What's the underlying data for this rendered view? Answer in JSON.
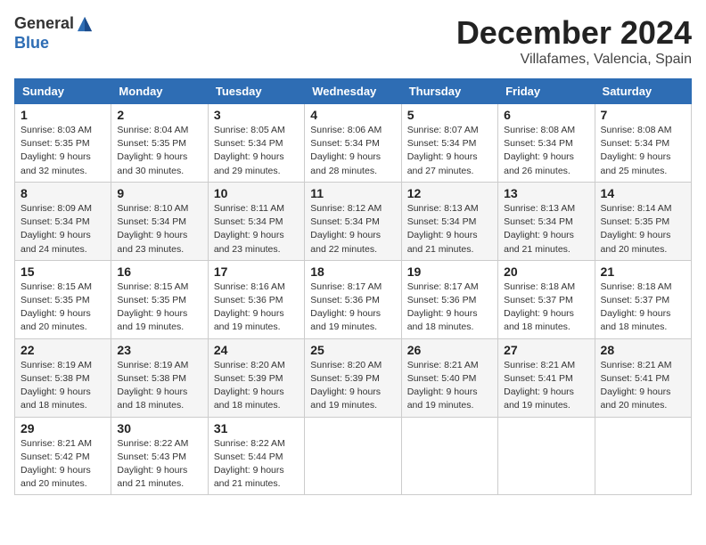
{
  "header": {
    "logo_general": "General",
    "logo_blue": "Blue",
    "month_title": "December 2024",
    "location": "Villafames, Valencia, Spain"
  },
  "weekdays": [
    "Sunday",
    "Monday",
    "Tuesday",
    "Wednesday",
    "Thursday",
    "Friday",
    "Saturday"
  ],
  "weeks": [
    [
      {
        "day": "1",
        "sunrise": "Sunrise: 8:03 AM",
        "sunset": "Sunset: 5:35 PM",
        "daylight": "Daylight: 9 hours and 32 minutes."
      },
      {
        "day": "2",
        "sunrise": "Sunrise: 8:04 AM",
        "sunset": "Sunset: 5:35 PM",
        "daylight": "Daylight: 9 hours and 30 minutes."
      },
      {
        "day": "3",
        "sunrise": "Sunrise: 8:05 AM",
        "sunset": "Sunset: 5:34 PM",
        "daylight": "Daylight: 9 hours and 29 minutes."
      },
      {
        "day": "4",
        "sunrise": "Sunrise: 8:06 AM",
        "sunset": "Sunset: 5:34 PM",
        "daylight": "Daylight: 9 hours and 28 minutes."
      },
      {
        "day": "5",
        "sunrise": "Sunrise: 8:07 AM",
        "sunset": "Sunset: 5:34 PM",
        "daylight": "Daylight: 9 hours and 27 minutes."
      },
      {
        "day": "6",
        "sunrise": "Sunrise: 8:08 AM",
        "sunset": "Sunset: 5:34 PM",
        "daylight": "Daylight: 9 hours and 26 minutes."
      },
      {
        "day": "7",
        "sunrise": "Sunrise: 8:08 AM",
        "sunset": "Sunset: 5:34 PM",
        "daylight": "Daylight: 9 hours and 25 minutes."
      }
    ],
    [
      {
        "day": "8",
        "sunrise": "Sunrise: 8:09 AM",
        "sunset": "Sunset: 5:34 PM",
        "daylight": "Daylight: 9 hours and 24 minutes."
      },
      {
        "day": "9",
        "sunrise": "Sunrise: 8:10 AM",
        "sunset": "Sunset: 5:34 PM",
        "daylight": "Daylight: 9 hours and 23 minutes."
      },
      {
        "day": "10",
        "sunrise": "Sunrise: 8:11 AM",
        "sunset": "Sunset: 5:34 PM",
        "daylight": "Daylight: 9 hours and 23 minutes."
      },
      {
        "day": "11",
        "sunrise": "Sunrise: 8:12 AM",
        "sunset": "Sunset: 5:34 PM",
        "daylight": "Daylight: 9 hours and 22 minutes."
      },
      {
        "day": "12",
        "sunrise": "Sunrise: 8:13 AM",
        "sunset": "Sunset: 5:34 PM",
        "daylight": "Daylight: 9 hours and 21 minutes."
      },
      {
        "day": "13",
        "sunrise": "Sunrise: 8:13 AM",
        "sunset": "Sunset: 5:34 PM",
        "daylight": "Daylight: 9 hours and 21 minutes."
      },
      {
        "day": "14",
        "sunrise": "Sunrise: 8:14 AM",
        "sunset": "Sunset: 5:35 PM",
        "daylight": "Daylight: 9 hours and 20 minutes."
      }
    ],
    [
      {
        "day": "15",
        "sunrise": "Sunrise: 8:15 AM",
        "sunset": "Sunset: 5:35 PM",
        "daylight": "Daylight: 9 hours and 20 minutes."
      },
      {
        "day": "16",
        "sunrise": "Sunrise: 8:15 AM",
        "sunset": "Sunset: 5:35 PM",
        "daylight": "Daylight: 9 hours and 19 minutes."
      },
      {
        "day": "17",
        "sunrise": "Sunrise: 8:16 AM",
        "sunset": "Sunset: 5:36 PM",
        "daylight": "Daylight: 9 hours and 19 minutes."
      },
      {
        "day": "18",
        "sunrise": "Sunrise: 8:17 AM",
        "sunset": "Sunset: 5:36 PM",
        "daylight": "Daylight: 9 hours and 19 minutes."
      },
      {
        "day": "19",
        "sunrise": "Sunrise: 8:17 AM",
        "sunset": "Sunset: 5:36 PM",
        "daylight": "Daylight: 9 hours and 18 minutes."
      },
      {
        "day": "20",
        "sunrise": "Sunrise: 8:18 AM",
        "sunset": "Sunset: 5:37 PM",
        "daylight": "Daylight: 9 hours and 18 minutes."
      },
      {
        "day": "21",
        "sunrise": "Sunrise: 8:18 AM",
        "sunset": "Sunset: 5:37 PM",
        "daylight": "Daylight: 9 hours and 18 minutes."
      }
    ],
    [
      {
        "day": "22",
        "sunrise": "Sunrise: 8:19 AM",
        "sunset": "Sunset: 5:38 PM",
        "daylight": "Daylight: 9 hours and 18 minutes."
      },
      {
        "day": "23",
        "sunrise": "Sunrise: 8:19 AM",
        "sunset": "Sunset: 5:38 PM",
        "daylight": "Daylight: 9 hours and 18 minutes."
      },
      {
        "day": "24",
        "sunrise": "Sunrise: 8:20 AM",
        "sunset": "Sunset: 5:39 PM",
        "daylight": "Daylight: 9 hours and 18 minutes."
      },
      {
        "day": "25",
        "sunrise": "Sunrise: 8:20 AM",
        "sunset": "Sunset: 5:39 PM",
        "daylight": "Daylight: 9 hours and 19 minutes."
      },
      {
        "day": "26",
        "sunrise": "Sunrise: 8:21 AM",
        "sunset": "Sunset: 5:40 PM",
        "daylight": "Daylight: 9 hours and 19 minutes."
      },
      {
        "day": "27",
        "sunrise": "Sunrise: 8:21 AM",
        "sunset": "Sunset: 5:41 PM",
        "daylight": "Daylight: 9 hours and 19 minutes."
      },
      {
        "day": "28",
        "sunrise": "Sunrise: 8:21 AM",
        "sunset": "Sunset: 5:41 PM",
        "daylight": "Daylight: 9 hours and 20 minutes."
      }
    ],
    [
      {
        "day": "29",
        "sunrise": "Sunrise: 8:21 AM",
        "sunset": "Sunset: 5:42 PM",
        "daylight": "Daylight: 9 hours and 20 minutes."
      },
      {
        "day": "30",
        "sunrise": "Sunrise: 8:22 AM",
        "sunset": "Sunset: 5:43 PM",
        "daylight": "Daylight: 9 hours and 21 minutes."
      },
      {
        "day": "31",
        "sunrise": "Sunrise: 8:22 AM",
        "sunset": "Sunset: 5:44 PM",
        "daylight": "Daylight: 9 hours and 21 minutes."
      },
      null,
      null,
      null,
      null
    ]
  ]
}
